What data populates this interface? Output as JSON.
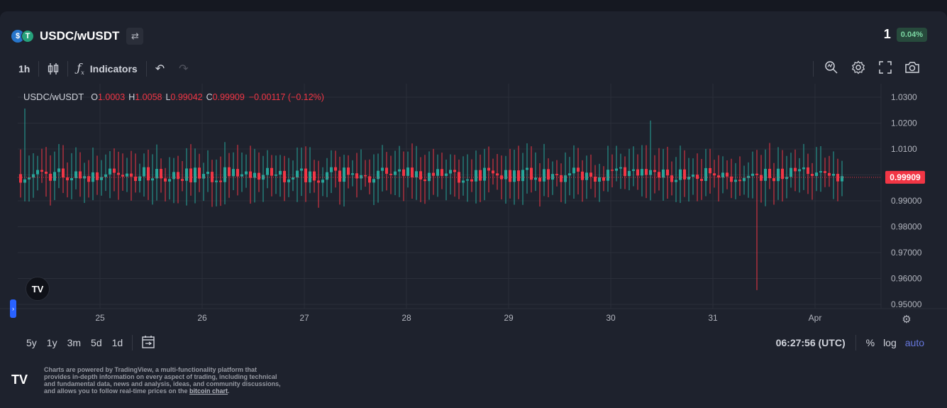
{
  "header": {
    "pair": "USDC/wUSDT",
    "coin1_icon": "usdc-coin-icon",
    "coin2_icon": "usdt-coin-icon",
    "swap_icon": "swap-icon",
    "price": "1",
    "change": "0.04%"
  },
  "toolbar": {
    "interval": "1h",
    "indicators_label": "Indicators",
    "icons": [
      "candles-icon",
      "function-icon",
      "undo-icon",
      "redo-icon",
      "zoom-icon",
      "gear-icon",
      "fullscreen-icon",
      "camera-icon"
    ]
  },
  "legend": {
    "symbol": "USDC/wUSDT",
    "o_label": "O",
    "o_value": "1.0003",
    "h_label": "H",
    "h_value": "1.0058",
    "l_label": "L",
    "l_value": "0.99042",
    "c_label": "C",
    "c_value": "0.99909",
    "change": "−0.00117 (−0.12%)"
  },
  "chart_data": {
    "type": "candlestick",
    "y_ticks": [
      "1.0300",
      "1.0200",
      "1.0100",
      "0.99000",
      "0.98000",
      "0.97000",
      "0.96000",
      "0.95000"
    ],
    "y_tick_values": [
      1.03,
      1.02,
      1.01,
      0.99,
      0.98,
      0.97,
      0.96,
      0.95
    ],
    "ylim": [
      0.947,
      1.033
    ],
    "x_ticks": [
      "25",
      "26",
      "27",
      "28",
      "29",
      "30",
      "31",
      "Apr"
    ],
    "last_price_label": "0.99909",
    "last_price": 0.99909,
    "notable_wicks": [
      {
        "at": "24 early",
        "high": 1.0256,
        "color": "up"
      },
      {
        "at": "30 mid",
        "high": 1.021,
        "color": "down"
      },
      {
        "at": "31 mid",
        "low": 0.9555,
        "color": "down"
      }
    ],
    "colors": {
      "up": "#26a69a",
      "down": "#f23645",
      "grid": "#2a2e39",
      "axis_text": "#b2b5be",
      "price_line": "#f23645"
    },
    "grid": true
  },
  "bottom": {
    "ranges": [
      "5y",
      "1y",
      "3m",
      "5d",
      "1d"
    ],
    "calendar_icon": "calendar-range-icon",
    "time": "06:27:56 (UTC)",
    "percent": "%",
    "log": "log",
    "auto": "auto"
  },
  "footer": {
    "text": "Charts are powered by TradingView, a multi-functionality platform that provides in-depth information on every aspect of trading, including technical and fundamental data, news and analysis, ideas, and community discussions, and allows you to follow real-time prices on the ",
    "link": "bitcoin chart",
    "end": "."
  },
  "widgets": {
    "tv_logo": "TV",
    "side_tab": "›"
  }
}
